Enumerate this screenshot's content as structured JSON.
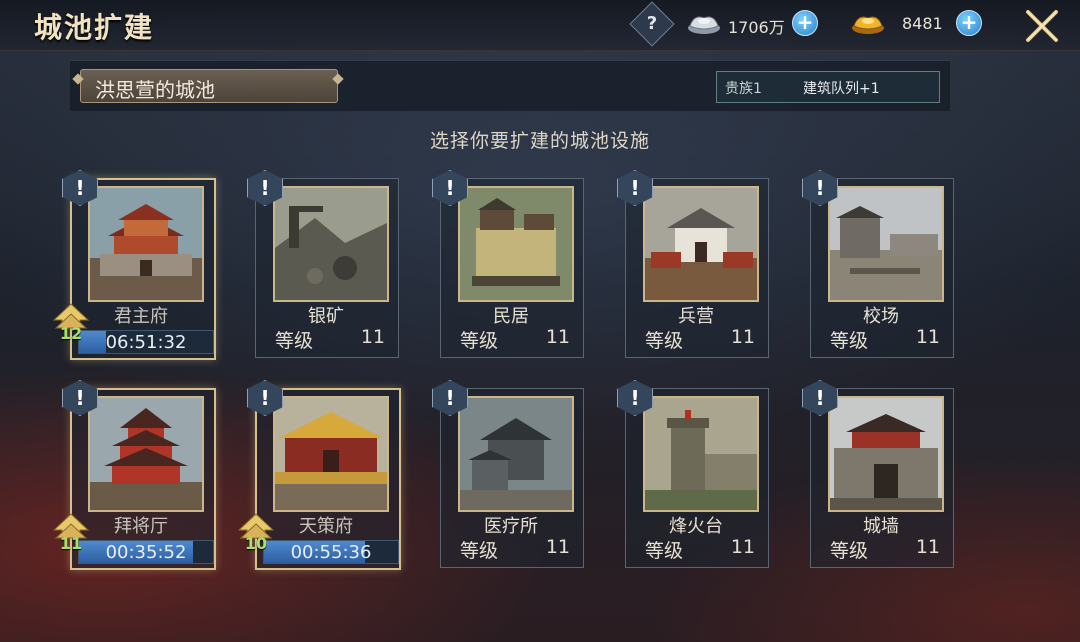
{
  "title": "城池扩建",
  "resources": {
    "help_label": "?",
    "silver": {
      "icon": "silver-ingot-icon",
      "value": "1706万"
    },
    "gold": {
      "icon": "gold-ingot-icon",
      "value": "8481"
    },
    "plus_label": "+"
  },
  "header": {
    "city_name": "洪思萱的城池",
    "noble_level": "贵族1",
    "noble_bonus": "建筑队列+1"
  },
  "subtitle": "选择你要扩建的城池设施",
  "alert_label": "!",
  "buildings": [
    {
      "name": "君主府",
      "upgrading": true,
      "level": "12",
      "timer": "06:51:32",
      "progress": 0.2,
      "image": "palace-image"
    },
    {
      "name": "银矿",
      "upgrading": false,
      "level_label": "等级",
      "level": "11",
      "image": "silver-mine-image"
    },
    {
      "name": "民居",
      "upgrading": false,
      "level_label": "等级",
      "level": "11",
      "image": "residence-image"
    },
    {
      "name": "兵营",
      "upgrading": false,
      "level_label": "等级",
      "level": "11",
      "image": "barracks-image"
    },
    {
      "name": "校场",
      "upgrading": false,
      "level_label": "等级",
      "level": "11",
      "image": "training-ground-image"
    },
    {
      "name": "拜将厅",
      "upgrading": true,
      "level": "11",
      "timer": "00:35:52",
      "progress": 0.85,
      "image": "general-hall-image"
    },
    {
      "name": "天策府",
      "upgrading": true,
      "level": "10",
      "timer": "00:55:36",
      "progress": 0.75,
      "image": "tiance-mansion-image"
    },
    {
      "name": "医疗所",
      "upgrading": false,
      "level_label": "等级",
      "level": "11",
      "image": "infirmary-image"
    },
    {
      "name": "烽火台",
      "upgrading": false,
      "level_label": "等级",
      "level": "11",
      "image": "beacon-tower-image"
    },
    {
      "name": "城墙",
      "upgrading": false,
      "level_label": "等级",
      "level": "11",
      "image": "city-wall-image"
    }
  ],
  "colors": {
    "accent_gold": "#cbb68b",
    "timer_blue": "#3b72b8",
    "level_green": "#a8e06a"
  }
}
